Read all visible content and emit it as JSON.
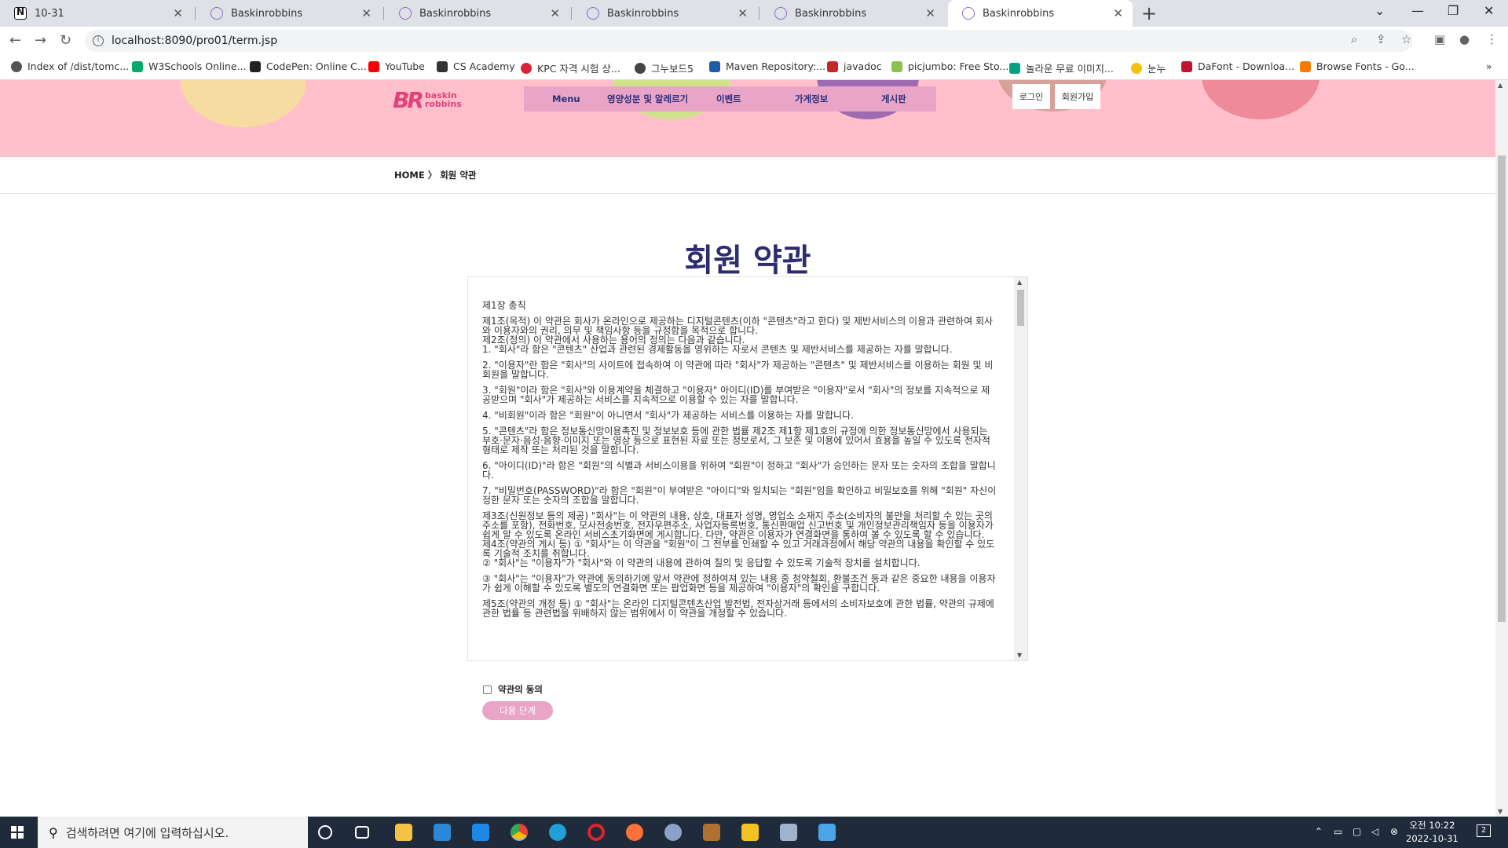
{
  "browser": {
    "tabs": [
      {
        "title": "10-31",
        "active": false
      },
      {
        "title": "Baskinrobbins",
        "active": false
      },
      {
        "title": "Baskinrobbins",
        "active": false
      },
      {
        "title": "Baskinrobbins",
        "active": false
      },
      {
        "title": "Baskinrobbins",
        "active": false
      },
      {
        "title": "Baskinrobbins",
        "active": true
      }
    ],
    "url": "localhost:8090/pro01/term.jsp",
    "bookmarks": [
      "Index of /dist/tomc...",
      "W3Schools Online...",
      "CodePen: Online C...",
      "YouTube",
      "CS Academy",
      "KPC 자격 시험 상...",
      "그누보드5",
      "Maven Repository:...",
      "javadoc",
      "picjumbo: Free Sto...",
      "놀라운 무료 이미지...",
      "눈누",
      "DaFont - Downloa...",
      "Browse Fonts - Go..."
    ]
  },
  "site": {
    "logo_text": "BR",
    "logo_sub1": "baskin",
    "logo_sub2": "robbins",
    "nav": [
      "Menu",
      "영양성분 및 알레르기",
      "이벤트",
      "가게정보",
      "게시판"
    ],
    "login": "로그인",
    "signup": "회원가입",
    "breadcrumb": "HOME 〉 회원 약관",
    "page_title": "회원 약관",
    "terms": [
      "제1장 총칙",
      "",
      "제1조(목적) 이 약관은 회사가 온라인으로 제공하는 디지털콘텐츠(이하 \"콘텐츠\"라고 한다) 및 제반서비스의 이용과 관련하여 회사와 이용자와의 권리, 의무 및 책임사항 등을 규정함을 목적으로 합니다.",
      "제2조(정의) 이 약관에서 사용하는 용어의 정의는 다음과 같습니다.",
      "1. \"회사\"라 함은 \"콘텐츠\" 산업과 관련된 경제활동을 영위하는 자로서 콘텐츠 및 제반서비스를 제공하는 자를 말합니다.",
      "",
      "2. \"이용자\"란 함은 \"회사\"의 사이트에 접속하여 이 약관에 따라 \"회사\"가 제공하는 \"콘텐츠\" 및 제반서비스를 이용하는 회원 및 비회원을 말합니다.",
      "",
      "3. \"회원\"이라 함은 \"회사\"와 이용계약을 체결하고 \"이용자\" 아이디(ID)를 부여받은 \"이용자\"로서 \"회사\"의 정보를 지속적으로 제공받으며 \"회사\"가 제공하는 서비스를 지속적으로 이용할 수 있는 자를 말합니다.",
      "",
      "4. \"비회원\"이라 함은 \"회원\"이 아니면서 \"회사\"가 제공하는 서비스를 이용하는 자를 말합니다.",
      "",
      "5. \"콘텐츠\"라 함은 정보통신망이용촉진 및 정보보호 등에 관한 법률 제2조 제1항 제1호의 규정에 의한 정보통신망에서 사용되는 부호·문자·음성·음향·이미지 또는 영상 등으로 표현된 자료 또는 정보로서, 그 보존 및 이용에 있어서 효용을 높일 수 있도록 전자적 형태로 제작 또는 처리된 것을 말합니다.",
      "",
      "6. \"아이디(ID)\"라 함은 \"회원\"의 식별과 서비스이용을 위하여 \"회원\"이 정하고 \"회사\"가 승인하는 문자 또는 숫자의 조합을 말합니다.",
      "",
      "7. \"비밀번호(PASSWORD)\"라 함은 \"회원\"이 부여받은 \"아이디\"와 일치되는 \"회원\"임을 확인하고 비밀보호를 위해 \"회원\" 자신이 정한 문자 또는 숫자의 조합을 말합니다.",
      "",
      "제3조(신원정보 등의 제공) \"회사\"는 이 약관의 내용, 상호, 대표자 성명, 영업소 소재지 주소(소비자의 불만을 처리할 수 있는 곳의 주소를 포함), 전화번호, 모사전송번호, 전자우편주소, 사업자등록번호, 통신판매업 신고번호 및 개인정보관리책임자 등을 이용자가 쉽게 알 수 있도록 온라인 서비스초기화면에 게시합니다. 다만, 약관은 이용자가 연결화면을 통하여 볼 수 있도록 할 수 있습니다.",
      "제4조(약관의 게시 등) ① \"회사\"는 이 약관을 \"회원\"이 그 전부를 인쇄할 수 있고 거래과정에서 해당 약관의 내용을 확인할 수 있도록 기술적 조치를 취합니다.",
      "② \"회사\"는 \"이용자\"가 \"회사\"와 이 약관의 내용에 관하여 질의 및 응답할 수 있도록 기술적 장치를 설치합니다.",
      "",
      "③ \"회사\"는 \"이용자\"가 약관에 동의하기에 앞서 약관에 정하여져 있는 내용 중 청약철회, 환불조건 등과 같은 중요한 내용을 이용자가 쉽게 이해할 수 있도록 별도의 연결화면 또는 팝업화면 등을 제공하여 \"이용자\"의 확인을 구합니다.",
      "",
      "제5조(약관의 개정 등) ① \"회사\"는 온라인 디지털콘텐츠산업 발전법, 전자상거래 등에서의 소비자보호에 관한 법률, 약관의 규제에 관한 법률 등 관련법을 위배하지 않는 범위에서 이 약관을 개정할 수 있습니다."
    ],
    "agree_label": "약관의 동의",
    "next_button": "다음 단계"
  },
  "taskbar": {
    "search_placeholder": "검색하려면 여기에 입력하십시오.",
    "time_line1": "오전 10:22",
    "time_line2": "2022-10-31",
    "notification_count": "2"
  },
  "colors": {
    "hero_bg": "#ffc0cb",
    "menu_bg": "#e8a5c8",
    "title": "#2d2d6e",
    "accent_button": "#e8a5c8"
  }
}
